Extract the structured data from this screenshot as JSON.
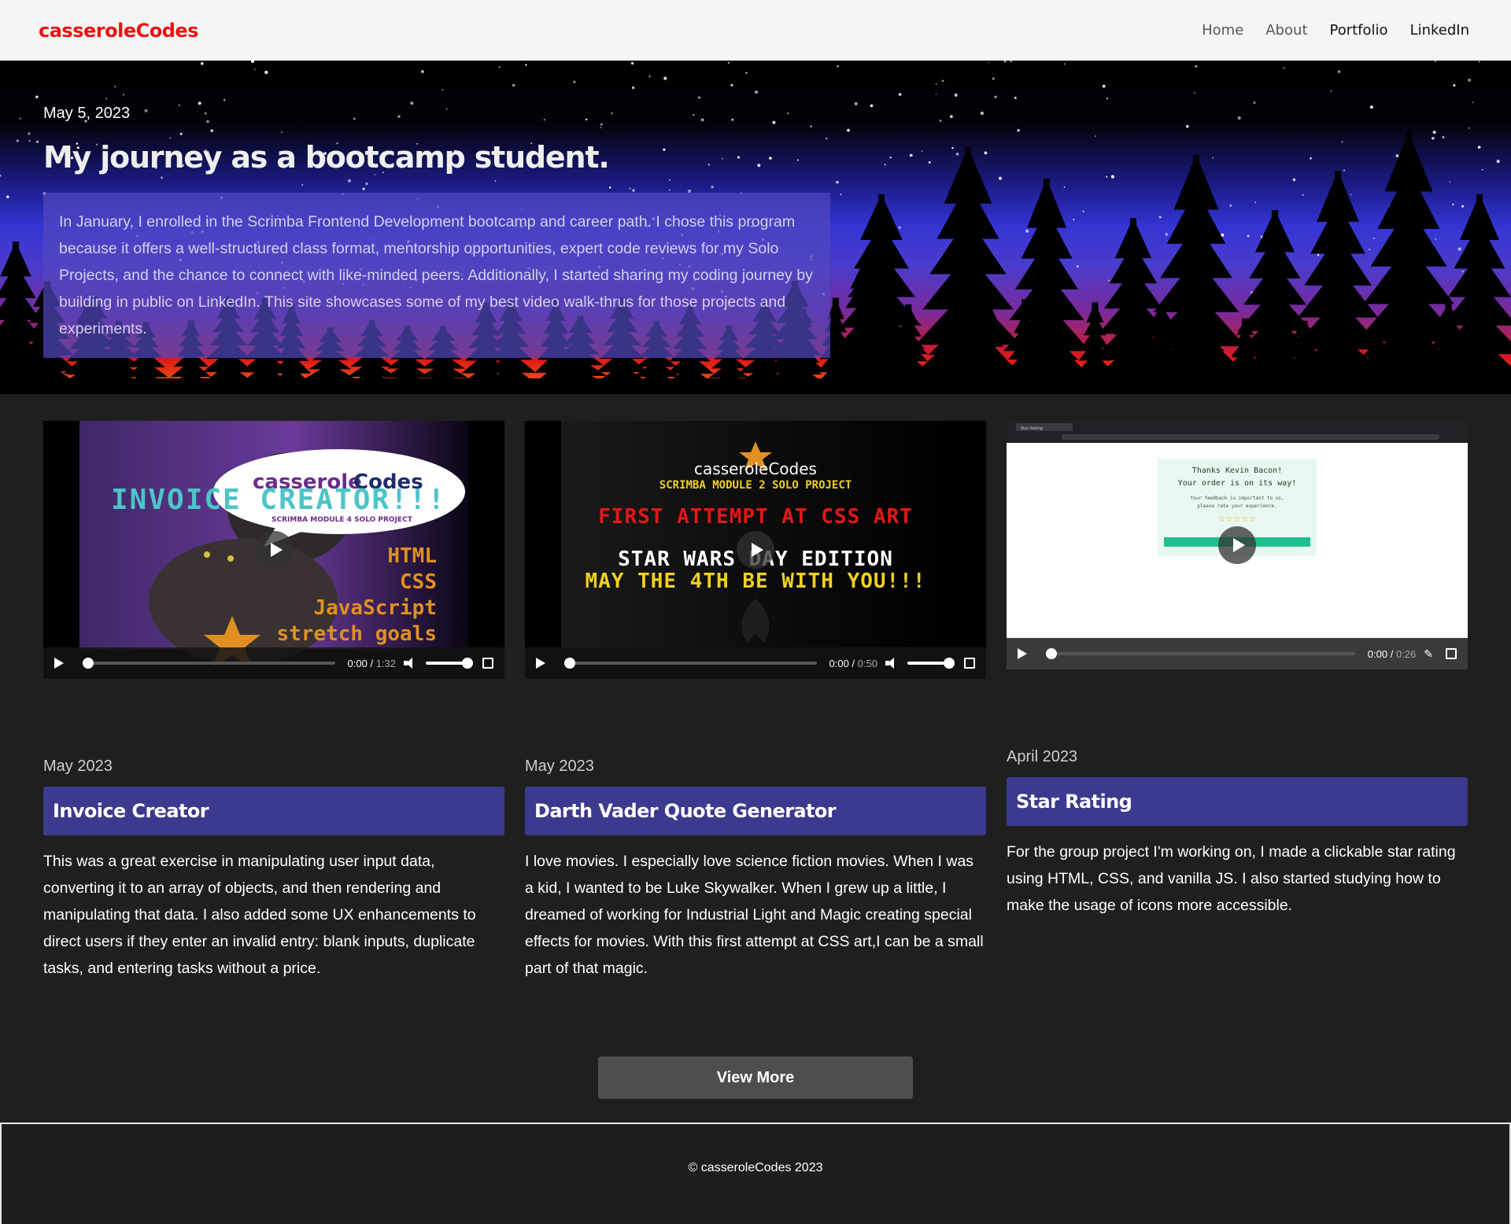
{
  "nav": {
    "logo": "casseroleCodes",
    "links": [
      {
        "label": "Home"
      },
      {
        "label": "About"
      },
      {
        "label": "Portfolio"
      },
      {
        "label": "LinkedIn"
      }
    ]
  },
  "hero": {
    "date": "May 5, 2023",
    "title": "My journey as a bootcamp student.",
    "text": "In January, I enrolled in the Scrimba Frontend Development bootcamp and career path. I chose this program because it offers a well-structured class format, mentorship opportunities, expert code reviews for my Solo Projects, and the chance to connect with like-minded peers. Additionally, I started sharing my coding journey by building in public on LinkedIn. This site showcases some of my best video walk-thrus for those projects and experiments."
  },
  "cards": [
    {
      "date": "May 2023",
      "title": "Invoice Creator",
      "text": "This was a great exercise in manipulating user input data, converting it to an array of objects, and then rendering and manipulating that data. I also added some UX enhancements to direct users if they enter an invalid entry: blank inputs, duplicate tasks, and entering tasks without a price.",
      "video": {
        "time": "0:00",
        "duration": "1:32",
        "thumb": {
          "brand_a": "casserole",
          "brand_b": "Codes",
          "headline": "INVOICE CREATOR!!!",
          "sub": "SCRIMBA MODULE 4 SOLO PROJECT",
          "items": [
            "HTML",
            "CSS",
            "JavaScript",
            "stretch goals"
          ]
        }
      }
    },
    {
      "date": "May 2023",
      "title": "Darth Vader Quote Generator",
      "text": "I love movies. I especially love science fiction movies. When I was a kid, I wanted to be Luke Skywalker. When I grew up a little, I dreamed of working for Industrial Light and Magic creating special effects for movies. With this first attempt at CSS art,I can be a small part of that magic.",
      "video": {
        "time": "0:00",
        "duration": "0:50",
        "thumb": {
          "brand": "casseroleCodes",
          "module": "SCRIMBA MODULE 2 SOLO PROJECT",
          "line1": "FIRST ATTEMPT AT CSS ART",
          "line2": "STAR WARS DAY EDITION",
          "line3": "MAY THE 4TH BE WITH YOU!!!"
        }
      }
    },
    {
      "date": "April 2023",
      "title": "Star Rating",
      "text": "For the group project I'm working on, I made a clickable star rating using HTML, CSS, and vanilla JS. I also started studying how to make the usage of icons more accessible.",
      "video": {
        "time": "0:00",
        "duration": "0:26",
        "thumb": {
          "line1": "Thanks Kevin Bacon!",
          "line2": "Your order is on its way!",
          "line3": "Your feedback is important to us,",
          "line4": "please rate your experience.",
          "tab": "Star Rating"
        }
      }
    }
  ],
  "view_more": "View More",
  "footer": "© casseroleCodes 2023",
  "colors": {
    "logo": "#f01010",
    "card_title_bg": "#3b3a8e",
    "page_bg": "#1f1f1f"
  }
}
